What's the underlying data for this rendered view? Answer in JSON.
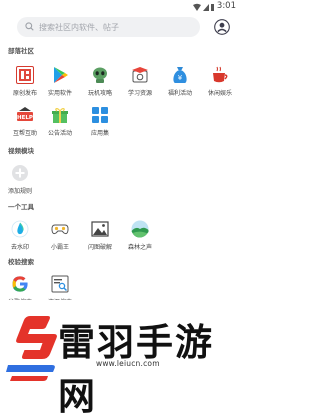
{
  "status": {
    "time": "3:01"
  },
  "search": {
    "placeholder": "搜索社区内软件、帖子"
  },
  "sections": [
    {
      "title": "部落社区",
      "items": [
        {
          "label": "原创发布",
          "icon": "original-post-icon"
        },
        {
          "label": "实用软件",
          "icon": "play-store-icon"
        },
        {
          "label": "玩机攻略",
          "icon": "android-icon"
        },
        {
          "label": "学习资源",
          "icon": "graduation-icon"
        },
        {
          "label": "福利活动",
          "icon": "money-bag-icon"
        },
        {
          "label": "休闲娱乐",
          "icon": "coffee-cup-icon"
        },
        {
          "label": "互帮互助",
          "icon": "help-sign-icon"
        },
        {
          "label": "公告活动",
          "icon": "gift-icon"
        },
        {
          "label": "应用集",
          "icon": "app-collection-icon"
        }
      ]
    },
    {
      "title": "视频模块",
      "items": [
        {
          "label": "添加规则",
          "icon": "add-circle-icon"
        }
      ]
    },
    {
      "title": "一个工具",
      "items": [
        {
          "label": "去水印",
          "icon": "watermark-remove-icon"
        },
        {
          "label": "小霸王",
          "icon": "gamepad-icon"
        },
        {
          "label": "闪图破解",
          "icon": "image-crack-icon"
        },
        {
          "label": "森林之声",
          "icon": "forest-landscape-icon"
        }
      ]
    },
    {
      "title": "校验搜索",
      "items": [
        {
          "label": "谷歌搜索",
          "icon": "google-icon"
        },
        {
          "label": "资源搜索",
          "icon": "resource-search-icon"
        }
      ]
    }
  ],
  "banner": {
    "brand": "雷羽手游网",
    "url": "www.leiucn.com"
  }
}
